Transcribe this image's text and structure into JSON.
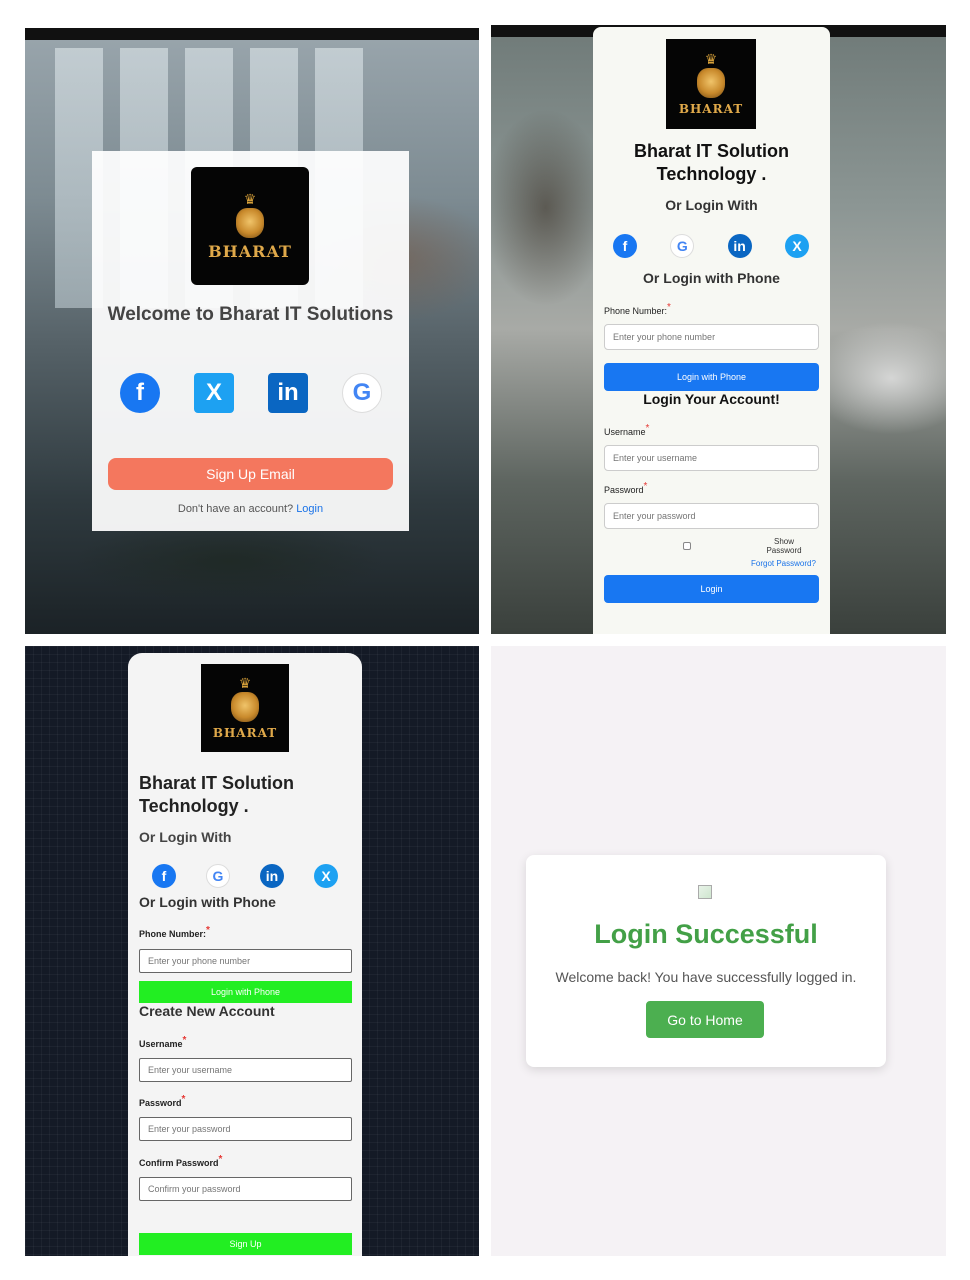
{
  "panel1": {
    "brand": "BHARAT",
    "welcome": "Welcome to Bharat IT Solutions",
    "social": [
      "f",
      "X",
      "in",
      "G"
    ],
    "signup_label": "Sign Up Email",
    "footer_text": "Don't have an account?",
    "footer_link": "Login"
  },
  "panel2": {
    "brand": "BHARAT",
    "title_line1": "Bharat IT Solution",
    "title_line2": "Technology .",
    "or_login_with": "Or Login With",
    "or_login_phone": "Or Login with Phone",
    "phone_label": "Phone Number:",
    "phone_placeholder": "Enter your phone number",
    "phone_button": "Login with Phone",
    "login_heading": "Login Your Account!",
    "username_label": "Username",
    "username_placeholder": "Enter your username",
    "password_label": "Password",
    "password_placeholder": "Enter your password",
    "show_password": "Show Password",
    "forgot": "Forgot Password?",
    "login_button": "Login",
    "required_mark": "*"
  },
  "panel3": {
    "brand": "BHARAT",
    "title_line1": "Bharat IT Solution",
    "title_line2": "Technology .",
    "or_login_with": "Or Login With",
    "or_login_phone": "Or Login with Phone",
    "phone_label": "Phone Number:",
    "phone_placeholder": "Enter your phone number",
    "phone_button": "Login with Phone",
    "create_heading": "Create New Account",
    "username_label": "Username",
    "username_placeholder": "Enter your username",
    "password_label": "Password",
    "password_placeholder": "Enter your password",
    "confirm_label": "Confirm Password",
    "confirm_placeholder": "Confirm your password",
    "signup_button": "Sign Up",
    "required_mark": "*"
  },
  "panel4": {
    "title": "Login Successful",
    "message": "Welcome back! You have successfully logged in.",
    "home_button": "Go to Home"
  },
  "colors": {
    "signup_orange": "#f4775e",
    "login_blue": "#1877f2",
    "signup_green": "#22ee22",
    "success_green": "#4caf50"
  }
}
